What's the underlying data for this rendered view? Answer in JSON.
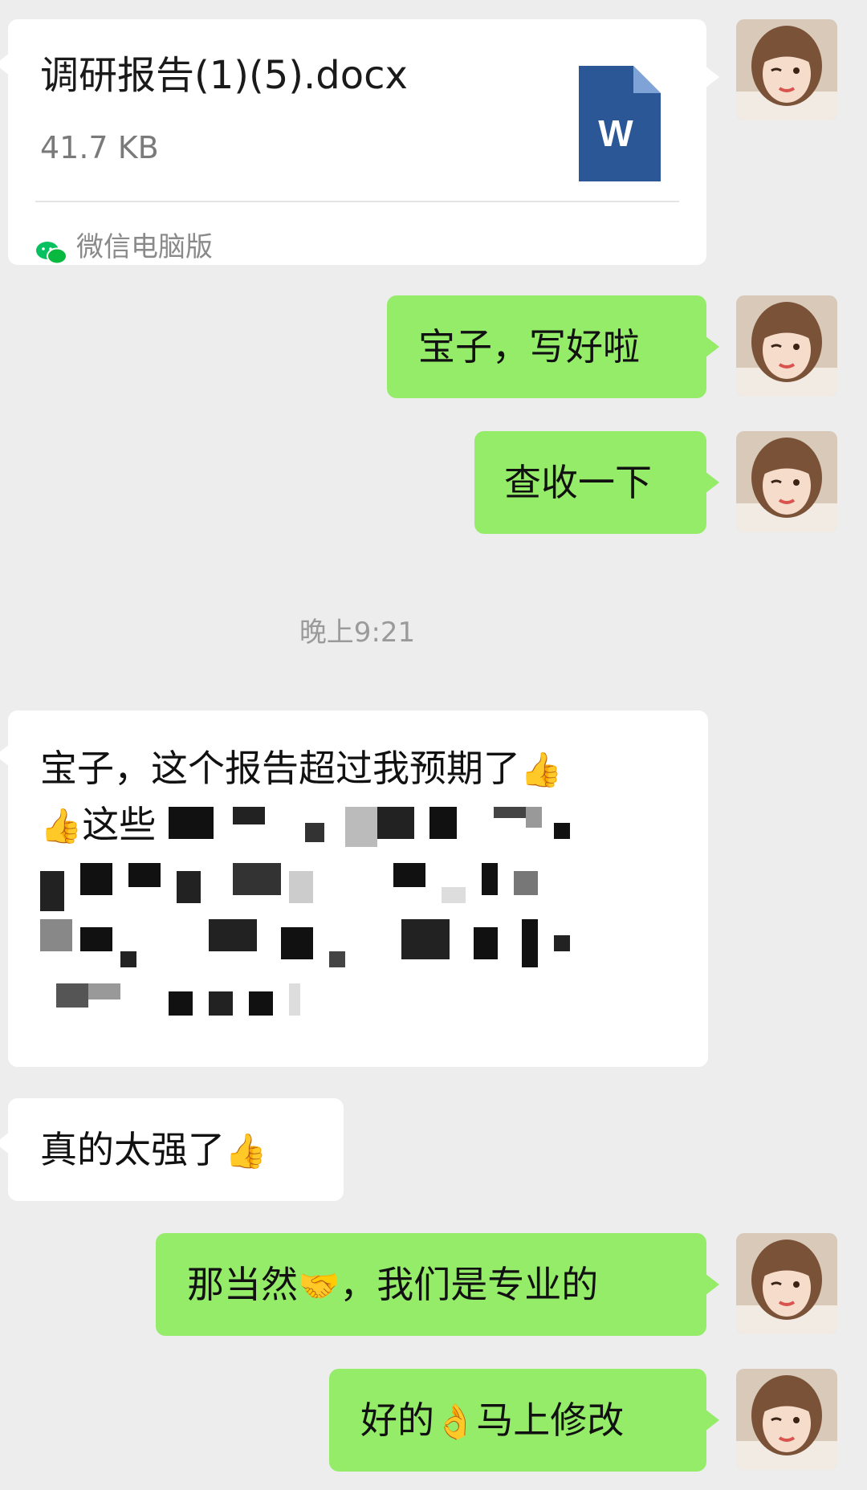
{
  "file_message": {
    "file_name": "调研报告(1)(5).docx",
    "file_size": "41.7 KB",
    "file_type_letter": "W",
    "source": "微信电脑版"
  },
  "messages_sent_1": [
    "宝子，写好啦",
    "查收一下"
  ],
  "timestamp": "晚上9:21",
  "received": {
    "message_1_text": "宝子，这个报告超过我预期了",
    "message_1_line2": "这些",
    "message_2_text": "真的太强了"
  },
  "messages_sent_2": {
    "message_1_before": "那当然",
    "message_1_after": "，我们是专业的",
    "message_2_before": "好的",
    "message_2_after": "马上修改"
  },
  "emoji": {
    "thumbs_up": "👍",
    "handshake": "🤝",
    "ok_hand": "👌"
  },
  "colors": {
    "background": "#ededed",
    "sent_bubble": "#95ec69",
    "received_bubble": "#ffffff",
    "word_icon": "#2b5797",
    "wechat_green": "#07c160"
  }
}
